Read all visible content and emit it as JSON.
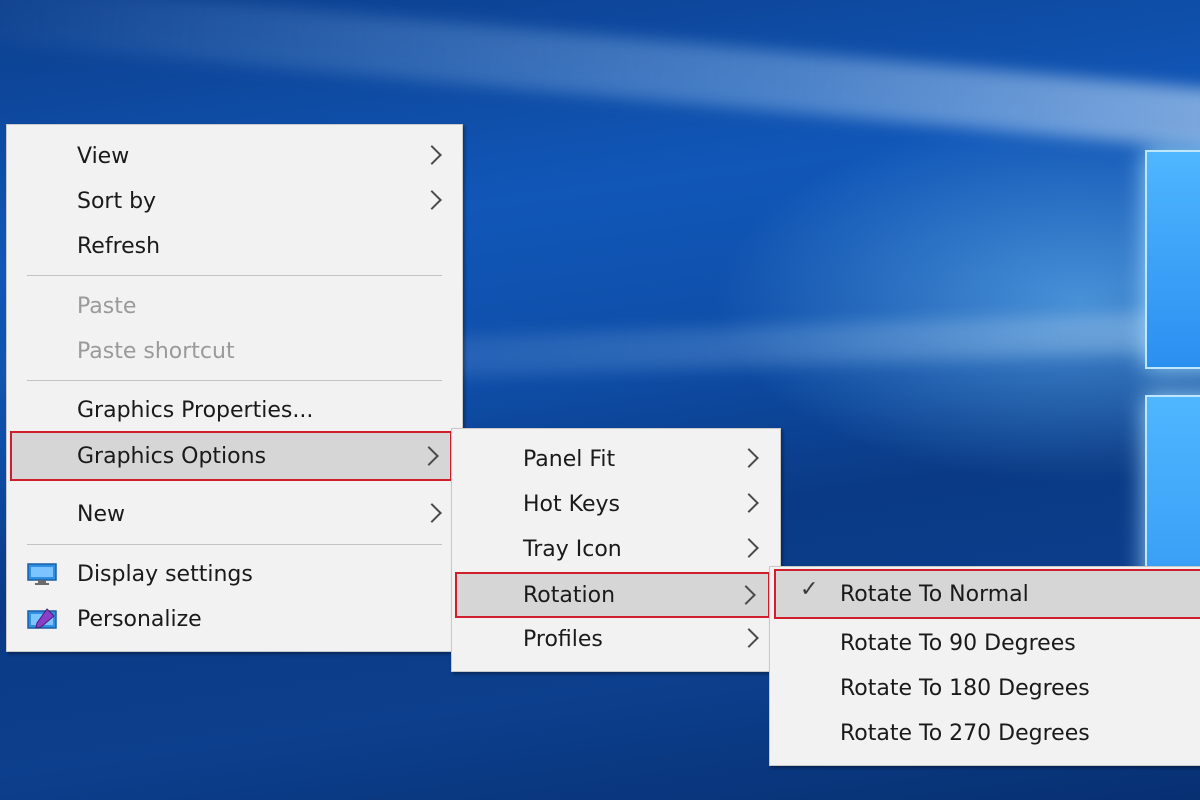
{
  "main_menu": {
    "items": [
      {
        "label": "View"
      },
      {
        "label": "Sort by"
      },
      {
        "label": "Refresh"
      },
      {
        "label": "Paste"
      },
      {
        "label": "Paste shortcut"
      },
      {
        "label": "Graphics Properties..."
      },
      {
        "label": "Graphics Options"
      },
      {
        "label": "New"
      },
      {
        "label": "Display settings",
        "icon": "display-settings-icon"
      },
      {
        "label": "Personalize",
        "icon": "personalize-icon"
      }
    ]
  },
  "graphics_submenu": {
    "items": [
      {
        "label": "Panel Fit"
      },
      {
        "label": "Hot Keys"
      },
      {
        "label": "Tray Icon"
      },
      {
        "label": "Rotation"
      },
      {
        "label": "Profiles"
      }
    ]
  },
  "rotation_submenu": {
    "check_glyph": "✓",
    "items": [
      {
        "label": "Rotate To Normal",
        "checked": true
      },
      {
        "label": "Rotate To 90 Degrees"
      },
      {
        "label": "Rotate To 180 Degrees"
      },
      {
        "label": "Rotate To 270 Degrees"
      }
    ]
  },
  "colors": {
    "highlight_border": "#d11e2c",
    "menu_background": "#f2f2f2",
    "desktop_blue": "#0e4ea8"
  }
}
